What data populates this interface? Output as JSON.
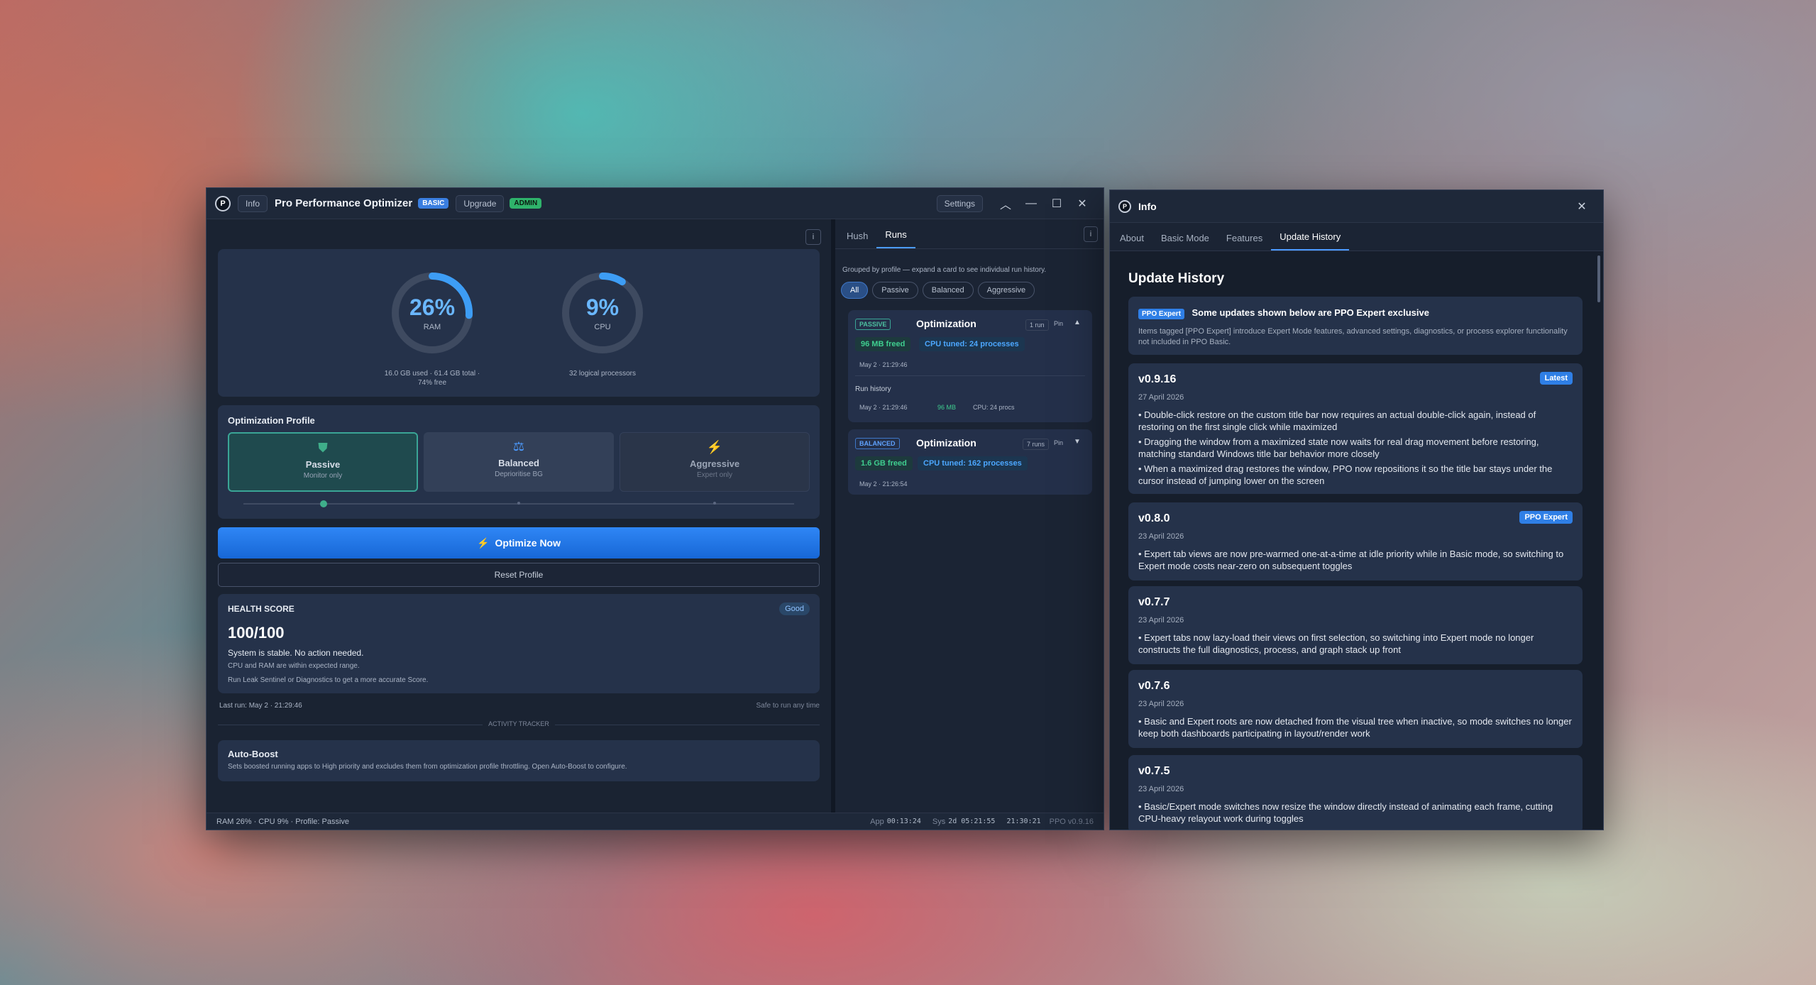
{
  "main": {
    "info_btn": "Info",
    "title": "Pro Performance Optimizer",
    "badge_basic": "BASIC",
    "upgrade_btn": "Upgrade",
    "badge_admin": "ADMIN",
    "settings_btn": "Settings",
    "ram": {
      "value": "26%",
      "label": "RAM",
      "percent": 26,
      "detail1": "16.0 GB used · 61.4 GB total ·",
      "detail2": "74% free"
    },
    "cpu": {
      "value": "9%",
      "label": "CPU",
      "percent": 9,
      "detail": "32 logical processors"
    },
    "profile": {
      "heading": "Optimization Profile",
      "cards": [
        {
          "name": "Passive",
          "desc": "Monitor only"
        },
        {
          "name": "Balanced",
          "desc": "Deprioritise BG"
        },
        {
          "name": "Aggressive",
          "desc": "Expert only"
        }
      ]
    },
    "optimize_btn": "Optimize Now",
    "reset_btn": "Reset Profile",
    "health": {
      "heading": "HEALTH SCORE",
      "badge": "Good",
      "score": "100/100",
      "status": "System is stable. No action needed.",
      "line1": "CPU and RAM are within expected range.",
      "line2": "Run Leak Sentinel or Diagnostics to get a more accurate Score."
    },
    "last_run": "Last run: May 2 · 21:29:46",
    "safe": "Safe to run any time",
    "activity_tracker": "ACTIVITY TRACKER",
    "autoboost": {
      "title": "Auto-Boost",
      "desc": "Sets boosted running apps to High priority and excludes them from optimization profile throttling. Open Auto-Boost to configure."
    },
    "side": {
      "tabs": [
        "Hush",
        "Runs"
      ],
      "hint": "Grouped by profile — expand a card to see individual run history.",
      "filters": [
        "All",
        "Passive",
        "Balanced",
        "Aggressive"
      ],
      "groups": [
        {
          "tag": "PASSIVE",
          "title": "Optimization",
          "runs": "1 run",
          "pin": "Pin",
          "chevron": "▲",
          "freed": "96 MB freed",
          "tuned": "CPU tuned: 24 processes",
          "time": "May 2 · 21:29:46",
          "history_label": "Run history",
          "hist_time": "May 2 · 21:29:46",
          "hist_freed": "96 MB",
          "hist_cpu": "CPU: 24 procs"
        },
        {
          "tag": "BALANCED",
          "title": "Optimization",
          "runs": "7 runs",
          "pin": "Pin",
          "chevron": "▼",
          "freed": "1.6 GB freed",
          "tuned": "CPU tuned: 162 processes",
          "time": "May 2 · 21:26:54"
        }
      ]
    },
    "statusbar": {
      "left": "RAM 26% · CPU 9% · Profile: Passive",
      "app_label": "App",
      "app": "00:13:24",
      "sys_label": "Sys",
      "sys": "2d 05:21:55",
      "clock": "21:30:21",
      "version": "PPO v0.9.16"
    }
  },
  "info": {
    "title": "Info",
    "tabs": [
      "About",
      "Basic Mode",
      "Features",
      "Update History"
    ],
    "heading": "Update History",
    "notice": {
      "badge": "PPO Expert",
      "title": "Some updates shown below are PPO Expert exclusive",
      "text": "Items tagged [PPO Expert] introduce Expert Mode features, advanced settings, diagnostics, or process explorer functionality not included in PPO Basic."
    },
    "versions": [
      {
        "ver": "v0.9.16",
        "badge": "Latest",
        "date": "27 April 2026",
        "bullets": [
          "• Double-click restore on the custom title bar now requires an actual double-click again, instead of restoring on the first single click while maximized",
          "• Dragging the window from a maximized state now waits for real drag movement before restoring, matching standard Windows title bar behavior more closely",
          "• When a maximized drag restores the window, PPO now repositions it so the title bar stays under the cursor instead of jumping lower on the screen"
        ]
      },
      {
        "ver": "v0.8.0",
        "badge": "PPO Expert",
        "date": "23 April 2026",
        "bullets": [
          "• Expert tab views are now pre-warmed one-at-a-time at idle priority while in Basic mode, so switching to Expert mode costs near-zero on subsequent toggles"
        ]
      },
      {
        "ver": "v0.7.7",
        "badge": "",
        "date": "23 April 2026",
        "bullets": [
          "• Expert tabs now lazy-load their views on first selection, so switching into Expert mode no longer constructs the full diagnostics, process, and graph stack up front"
        ]
      },
      {
        "ver": "v0.7.6",
        "badge": "",
        "date": "23 April 2026",
        "bullets": [
          "• Basic and Expert roots are now detached from the visual tree when inactive, so mode switches no longer keep both dashboards participating in layout/render work"
        ]
      },
      {
        "ver": "v0.7.5",
        "badge": "",
        "date": "23 April 2026",
        "bullets": [
          "• Basic/Expert mode switches now resize the window directly instead of animating each frame, cutting CPU-heavy relayout work during toggles"
        ]
      }
    ]
  }
}
